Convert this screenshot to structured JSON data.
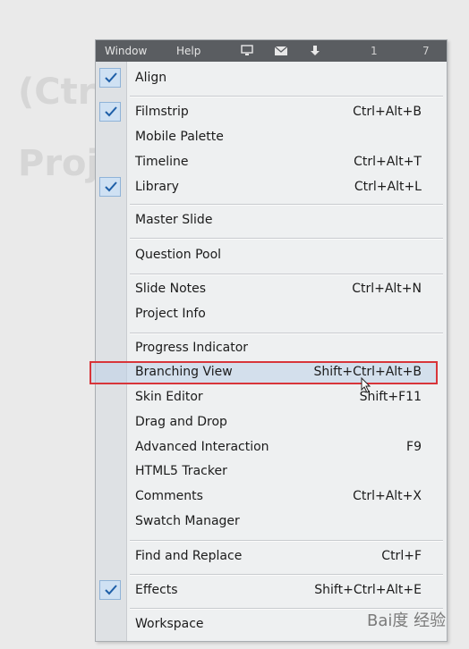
{
  "menubar": {
    "window": "Window",
    "help": "Help",
    "num_one": "1",
    "num_seven": "7"
  },
  "items": [
    {
      "label": "Align",
      "shortcut": "",
      "checked": true
    },
    {
      "label": "Filmstrip",
      "shortcut": "Ctrl+Alt+B",
      "checked": true
    },
    {
      "label": "Mobile Palette",
      "shortcut": "",
      "checked": false
    },
    {
      "label": "Timeline",
      "shortcut": "Ctrl+Alt+T",
      "checked": false
    },
    {
      "label": "Library",
      "shortcut": "Ctrl+Alt+L",
      "checked": true
    },
    {
      "label": "Master Slide",
      "shortcut": "",
      "checked": false
    },
    {
      "label": "Question Pool",
      "shortcut": "",
      "checked": false
    },
    {
      "label": "Slide Notes",
      "shortcut": "Ctrl+Alt+N",
      "checked": false
    },
    {
      "label": "Project Info",
      "shortcut": "",
      "checked": false
    },
    {
      "label": "Progress Indicator",
      "shortcut": "",
      "checked": false
    },
    {
      "label": "Branching View",
      "shortcut": "Shift+Ctrl+Alt+B",
      "checked": false
    },
    {
      "label": "Skin Editor",
      "shortcut": "Shift+F11",
      "checked": false
    },
    {
      "label": "Drag and Drop",
      "shortcut": "",
      "checked": false
    },
    {
      "label": "Advanced Interaction",
      "shortcut": "F9",
      "checked": false
    },
    {
      "label": "HTML5 Tracker",
      "shortcut": "",
      "checked": false
    },
    {
      "label": "Comments",
      "shortcut": "Ctrl+Alt+X",
      "checked": false
    },
    {
      "label": "Swatch Manager",
      "shortcut": "",
      "checked": false
    },
    {
      "label": "Find and Replace",
      "shortcut": "Ctrl+F",
      "checked": false
    },
    {
      "label": "Effects",
      "shortcut": "Shift+Ctrl+Alt+E",
      "checked": true
    },
    {
      "label": "Workspace",
      "shortcut": "",
      "checked": false
    }
  ],
  "highlighted_item": "Branching View",
  "watermark": "Bai度 经验",
  "colors": {
    "menubar_bg": "#5a5d61",
    "highlight_border": "#d8353a",
    "check_bg": "#cfe1f3"
  }
}
